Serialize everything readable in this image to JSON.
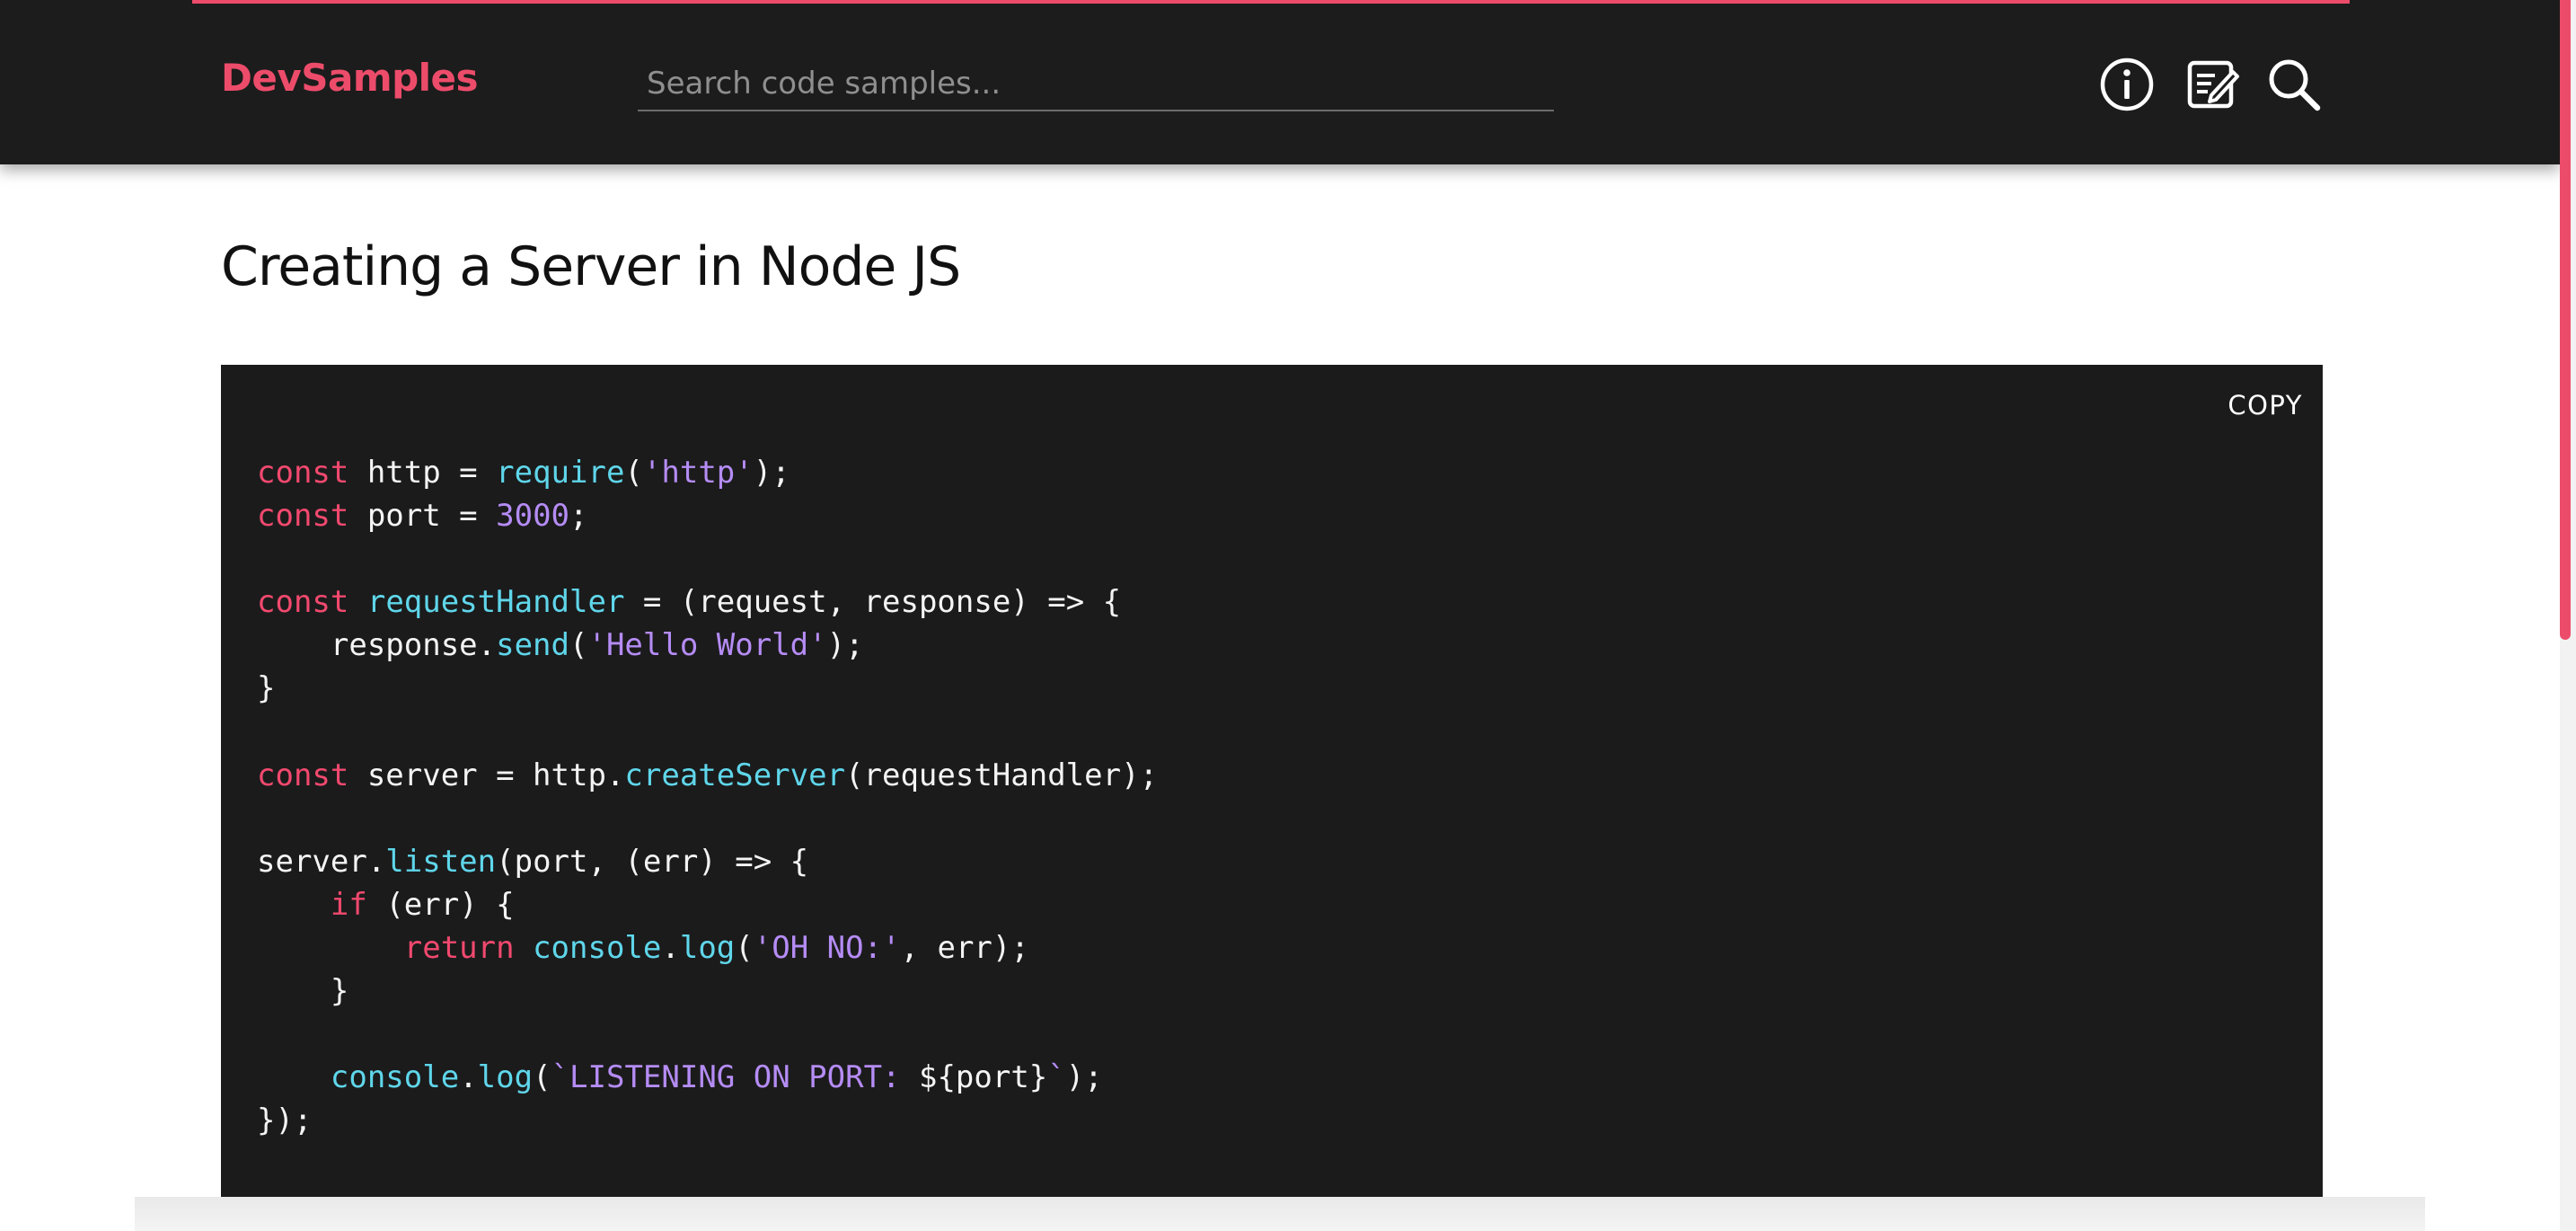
{
  "app": {
    "brand": "DevSamples"
  },
  "search": {
    "placeholder": "Search code samples..."
  },
  "header_icons": [
    {
      "name": "info-icon"
    },
    {
      "name": "notepad-icon"
    },
    {
      "name": "search-icon"
    }
  ],
  "page": {
    "title": "Creating a Server in Node JS"
  },
  "code_card": {
    "copy_label": "COPY",
    "lines": [
      [
        {
          "t": "keyword",
          "v": "const"
        },
        {
          "t": "plain",
          "v": " http = "
        },
        {
          "t": "func",
          "v": "require"
        },
        {
          "t": "plain",
          "v": "("
        },
        {
          "t": "string",
          "v": "'http'"
        },
        {
          "t": "plain",
          "v": ");"
        }
      ],
      [
        {
          "t": "keyword",
          "v": "const"
        },
        {
          "t": "plain",
          "v": " port = "
        },
        {
          "t": "number",
          "v": "3000"
        },
        {
          "t": "plain",
          "v": ";"
        }
      ],
      [],
      [
        {
          "t": "keyword",
          "v": "const"
        },
        {
          "t": "plain",
          "v": " "
        },
        {
          "t": "func",
          "v": "requestHandler"
        },
        {
          "t": "plain",
          "v": " = (request, response) => {"
        }
      ],
      [
        {
          "t": "plain",
          "v": "    response."
        },
        {
          "t": "func",
          "v": "send"
        },
        {
          "t": "plain",
          "v": "("
        },
        {
          "t": "string",
          "v": "'Hello World'"
        },
        {
          "t": "plain",
          "v": ");"
        }
      ],
      [
        {
          "t": "plain",
          "v": "}"
        }
      ],
      [],
      [
        {
          "t": "keyword",
          "v": "const"
        },
        {
          "t": "plain",
          "v": " server = http."
        },
        {
          "t": "func",
          "v": "createServer"
        },
        {
          "t": "plain",
          "v": "(requestHandler);"
        }
      ],
      [],
      [
        {
          "t": "plain",
          "v": "server."
        },
        {
          "t": "func",
          "v": "listen"
        },
        {
          "t": "plain",
          "v": "(port, (err) => {"
        }
      ],
      [
        {
          "t": "plain",
          "v": "    "
        },
        {
          "t": "keyword",
          "v": "if"
        },
        {
          "t": "plain",
          "v": " (err) {"
        }
      ],
      [
        {
          "t": "plain",
          "v": "        "
        },
        {
          "t": "keyword",
          "v": "return"
        },
        {
          "t": "plain",
          "v": " "
        },
        {
          "t": "func",
          "v": "console"
        },
        {
          "t": "plain",
          "v": "."
        },
        {
          "t": "func",
          "v": "log"
        },
        {
          "t": "plain",
          "v": "("
        },
        {
          "t": "string",
          "v": "'OH NO:'"
        },
        {
          "t": "plain",
          "v": ", err);"
        }
      ],
      [
        {
          "t": "plain",
          "v": "    }"
        }
      ],
      [],
      [
        {
          "t": "plain",
          "v": "    "
        },
        {
          "t": "func",
          "v": "console"
        },
        {
          "t": "plain",
          "v": "."
        },
        {
          "t": "func",
          "v": "log"
        },
        {
          "t": "plain",
          "v": "("
        },
        {
          "t": "string",
          "v": "`LISTENING ON PORT: "
        },
        {
          "t": "plain",
          "v": "${port}"
        },
        {
          "t": "string",
          "v": "`"
        },
        {
          "t": "plain",
          "v": ");"
        }
      ],
      [
        {
          "t": "plain",
          "v": "});"
        }
      ]
    ]
  },
  "colors": {
    "accent": "#ec4c6a",
    "header_bg": "#1c1c1c",
    "code_bg": "#1b1b1c",
    "keyword": "#f2496e",
    "function": "#5fd6ea",
    "string": "#b58cf5",
    "text": "#f4f4f4"
  }
}
